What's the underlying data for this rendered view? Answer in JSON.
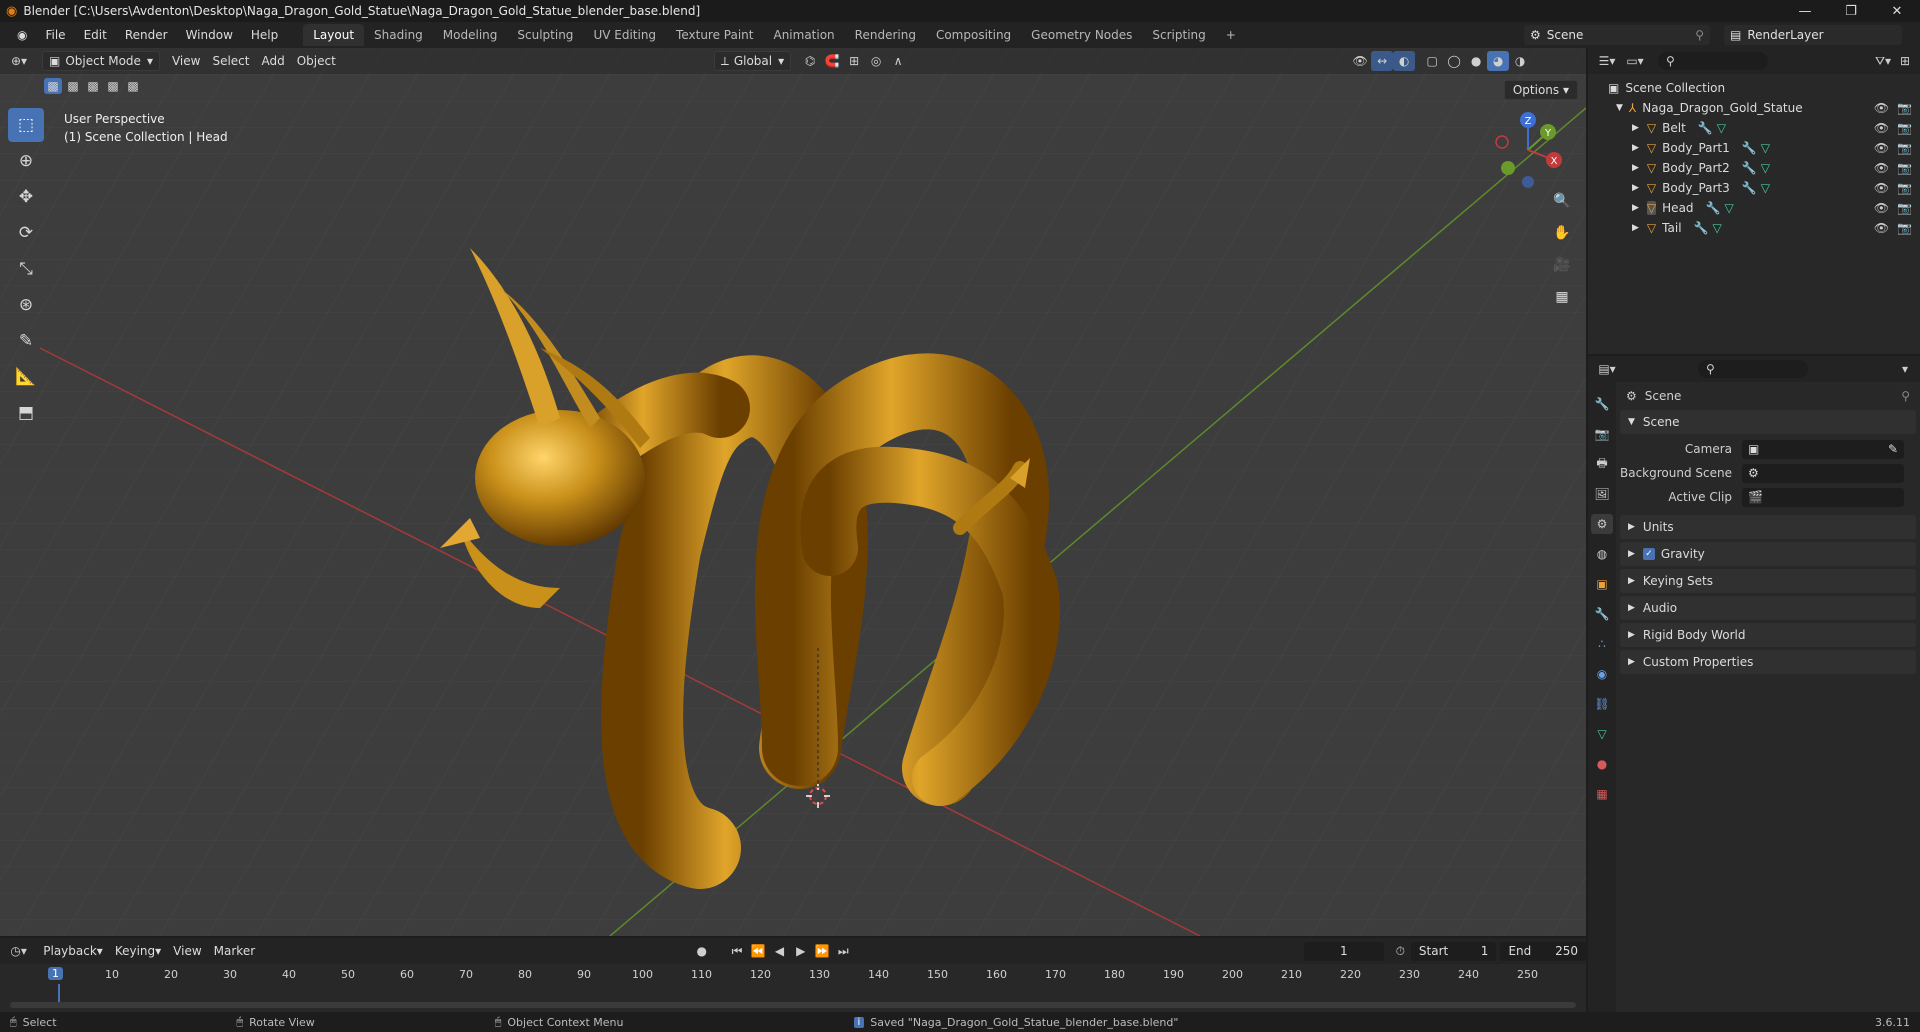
{
  "window": {
    "title": "Blender [C:\\Users\\Avdenton\\Desktop\\Naga_Dragon_Gold_Statue\\Naga_Dragon_Gold_Statue_blender_base.blend]",
    "controls": [
      "—",
      "❐",
      "✕"
    ]
  },
  "menu": [
    "File",
    "Edit",
    "Render",
    "Window",
    "Help"
  ],
  "workspaces": [
    "Layout",
    "Shading",
    "Modeling",
    "Sculpting",
    "UV Editing",
    "Texture Paint",
    "Animation",
    "Rendering",
    "Compositing",
    "Geometry Nodes",
    "Scripting"
  ],
  "active_workspace": "Layout",
  "scene_name": "Scene",
  "view_layer": "RenderLayer",
  "viewport": {
    "mode": "Object Mode",
    "menus": [
      "View",
      "Select",
      "Add",
      "Object"
    ],
    "orientation": "Global",
    "options_label": "Options",
    "overlay_line1": "User Perspective",
    "overlay_line2": "(1) Scene Collection | Head",
    "gizmo_axes": [
      "Z",
      "Y",
      "X"
    ]
  },
  "outliner": {
    "root": "Scene Collection",
    "collection": "Naga_Dragon_Gold_Statue",
    "objects": [
      "Belt",
      "Body_Part1",
      "Body_Part2",
      "Body_Part3",
      "Head",
      "Tail"
    ],
    "selected": "Head"
  },
  "properties": {
    "context": "Scene",
    "panel": "Scene",
    "fields": [
      {
        "label": "Camera",
        "value": ""
      },
      {
        "label": "Background Scene",
        "value": ""
      },
      {
        "label": "Active Clip",
        "value": ""
      }
    ],
    "subpanels": [
      "Units",
      "Gravity",
      "Keying Sets",
      "Audio",
      "Rigid Body World",
      "Custom Properties"
    ],
    "gravity_checked": true
  },
  "timeline": {
    "menus": [
      "Playback",
      "Keying",
      "View",
      "Marker"
    ],
    "current_frame": "1",
    "start_label": "Start",
    "start": "1",
    "end_label": "End",
    "end": "250",
    "ticks": [
      "1",
      "10",
      "20",
      "30",
      "40",
      "50",
      "60",
      "70",
      "80",
      "90",
      "100",
      "110",
      "120",
      "130",
      "140",
      "150",
      "160",
      "170",
      "180",
      "190",
      "200",
      "210",
      "220",
      "230",
      "240",
      "250"
    ]
  },
  "status": {
    "select": "Select",
    "rotate": "Rotate View",
    "context_menu": "Object Context Menu",
    "message": "Saved \"Naga_Dragon_Gold_Statue_blender_base.blend\"",
    "version": "3.6.11"
  },
  "colors": {
    "accent": "#4772b3",
    "gold": "#c9901a",
    "x_axis": "#c23b3b",
    "y_axis": "#6a9a2a",
    "z_axis": "#3d6fd6"
  }
}
